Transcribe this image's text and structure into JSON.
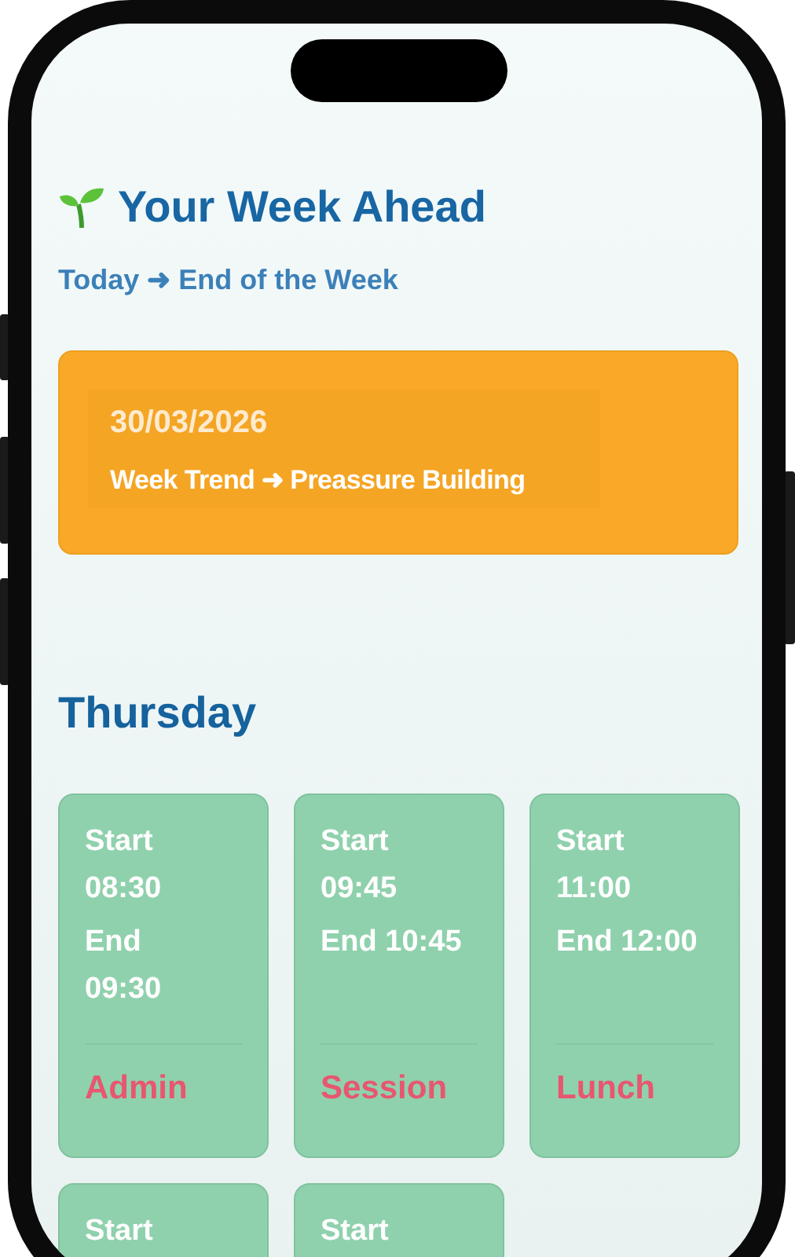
{
  "header": {
    "title": "Your Week Ahead",
    "subtitle": "Today ➜ End of the Week"
  },
  "trend_card": {
    "date": "30/03/2026",
    "trend": "Week Trend ➜ Preassure Building"
  },
  "day": {
    "title": "Thursday",
    "sessions": [
      {
        "lines": [
          "Start",
          "08:30",
          "End",
          "09:30"
        ],
        "label": "Admin"
      },
      {
        "lines": [
          "Start",
          "09:45",
          "End 10:45"
        ],
        "label": "Session"
      },
      {
        "lines": [
          "Start",
          "11:00",
          "End 12:00"
        ],
        "label": "Lunch"
      },
      {
        "lines": [
          "Start"
        ]
      },
      {
        "lines": [
          "Start"
        ]
      }
    ]
  }
}
